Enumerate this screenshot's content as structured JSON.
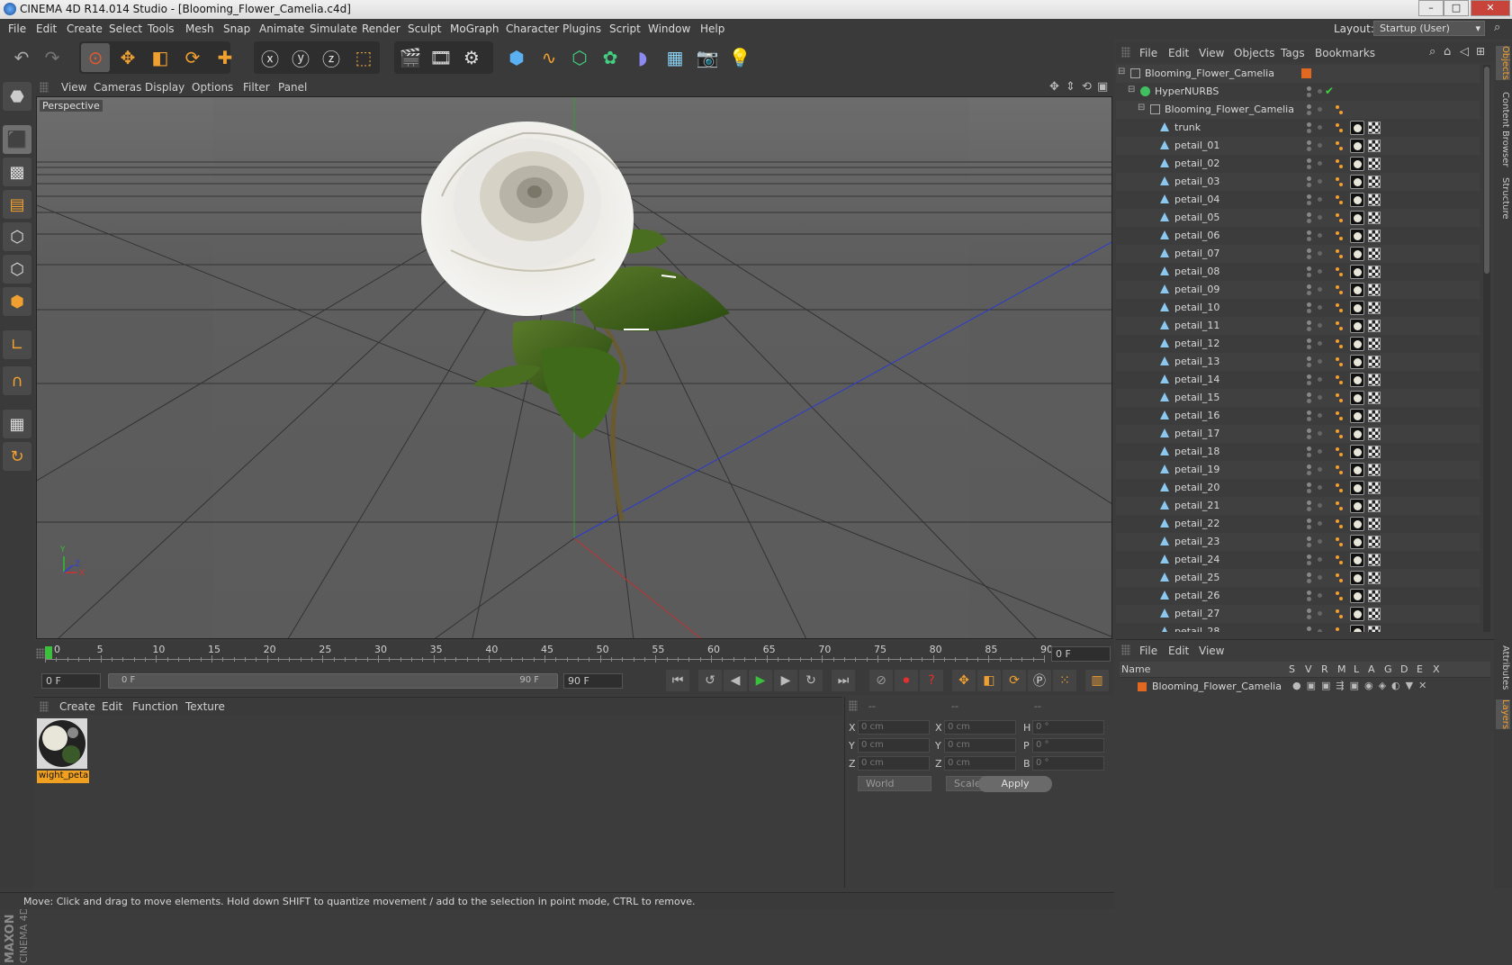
{
  "window": {
    "title": "CINEMA 4D R14.014 Studio - [Blooming_Flower_Camelia.c4d]",
    "minimize": "–",
    "maximize": "□",
    "close": "✕"
  },
  "menu": [
    "File",
    "Edit",
    "Create",
    "Select",
    "Tools",
    "Mesh",
    "Snap",
    "Animate",
    "Simulate",
    "Render",
    "Sculpt",
    "MoGraph",
    "Character",
    "Plugins",
    "Script",
    "Window",
    "Help"
  ],
  "layout": {
    "label": "Layout:",
    "value": "Startup (User)"
  },
  "viewport": {
    "menu": [
      "View",
      "Cameras",
      "Display",
      "Options",
      "Filter",
      "Panel"
    ],
    "label": "Perspective",
    "axis_y": "Y",
    "axis_z": "Z",
    "axis_x": "X"
  },
  "timeline": {
    "ticks": [
      "0",
      "5",
      "10",
      "15",
      "20",
      "25",
      "30",
      "35",
      "40",
      "45",
      "50",
      "55",
      "60",
      "65",
      "70",
      "75",
      "80",
      "85",
      "90"
    ],
    "frame": "0 F",
    "start_field": "0 F",
    "range_start": "0 F",
    "range_end": "90 F",
    "end_field": "90 F"
  },
  "materials": {
    "menu": [
      "Create",
      "Edit",
      "Function",
      "Texture"
    ],
    "items": [
      {
        "name": "wight_peta"
      }
    ]
  },
  "coords": {
    "headers": [
      "--",
      "--",
      "--"
    ],
    "rows": [
      {
        "a": "X",
        "av": "0 cm",
        "b": "X",
        "bv": "0 cm",
        "c": "H",
        "cv": "0 °"
      },
      {
        "a": "Y",
        "av": "0 cm",
        "b": "Y",
        "bv": "0 cm",
        "c": "P",
        "cv": "0 °"
      },
      {
        "a": "Z",
        "av": "0 cm",
        "b": "Z",
        "bv": "0 cm",
        "c": "B",
        "cv": "0 °"
      }
    ],
    "space": "World",
    "mode": "Scale",
    "apply": "Apply"
  },
  "status": "Move: Click and drag to move elements. Hold down SHIFT to quantize movement / add to the selection in point mode, CTRL to remove.",
  "objects": {
    "menu": [
      "File",
      "Edit",
      "View",
      "Objects",
      "Tags",
      "Bookmarks"
    ],
    "tree": [
      {
        "name": "Blooming_Flower_Camelia",
        "level": 0,
        "type": "null"
      },
      {
        "name": "HyperNURBS",
        "level": 1,
        "type": "nurbs"
      },
      {
        "name": "Blooming_Flower_Camelia",
        "level": 2,
        "type": "null"
      },
      {
        "name": "trunk",
        "level": 3,
        "type": "poly"
      },
      {
        "name": "petail_01",
        "level": 3,
        "type": "poly"
      },
      {
        "name": "petail_02",
        "level": 3,
        "type": "poly"
      },
      {
        "name": "petail_03",
        "level": 3,
        "type": "poly"
      },
      {
        "name": "petail_04",
        "level": 3,
        "type": "poly"
      },
      {
        "name": "petail_05",
        "level": 3,
        "type": "poly"
      },
      {
        "name": "petail_06",
        "level": 3,
        "type": "poly"
      },
      {
        "name": "petail_07",
        "level": 3,
        "type": "poly"
      },
      {
        "name": "petail_08",
        "level": 3,
        "type": "poly"
      },
      {
        "name": "petail_09",
        "level": 3,
        "type": "poly"
      },
      {
        "name": "petail_10",
        "level": 3,
        "type": "poly"
      },
      {
        "name": "petail_11",
        "level": 3,
        "type": "poly"
      },
      {
        "name": "petail_12",
        "level": 3,
        "type": "poly"
      },
      {
        "name": "petail_13",
        "level": 3,
        "type": "poly"
      },
      {
        "name": "petail_14",
        "level": 3,
        "type": "poly"
      },
      {
        "name": "petail_15",
        "level": 3,
        "type": "poly"
      },
      {
        "name": "petail_16",
        "level": 3,
        "type": "poly"
      },
      {
        "name": "petail_17",
        "level": 3,
        "type": "poly"
      },
      {
        "name": "petail_18",
        "level": 3,
        "type": "poly"
      },
      {
        "name": "petail_19",
        "level": 3,
        "type": "poly"
      },
      {
        "name": "petail_20",
        "level": 3,
        "type": "poly"
      },
      {
        "name": "petail_21",
        "level": 3,
        "type": "poly"
      },
      {
        "name": "petail_22",
        "level": 3,
        "type": "poly"
      },
      {
        "name": "petail_23",
        "level": 3,
        "type": "poly"
      },
      {
        "name": "petail_24",
        "level": 3,
        "type": "poly"
      },
      {
        "name": "petail_25",
        "level": 3,
        "type": "poly"
      },
      {
        "name": "petail_26",
        "level": 3,
        "type": "poly"
      },
      {
        "name": "petail_27",
        "level": 3,
        "type": "poly"
      },
      {
        "name": "petail_28",
        "level": 3,
        "type": "poly"
      }
    ]
  },
  "side_tabs": [
    "Objects",
    "Content Browser",
    "Structure",
    "Attributes",
    "Layers"
  ],
  "layers": {
    "menu": [
      "File",
      "Edit",
      "View"
    ],
    "columns": [
      "Name",
      "S",
      "V",
      "R",
      "M",
      "L",
      "A",
      "G",
      "D",
      "E",
      "X"
    ],
    "rows": [
      {
        "name": "Blooming_Flower_Camelia",
        "color": "#e06820"
      }
    ]
  },
  "colors": {
    "accent": "#f0a030",
    "selection_orange": "#e06820",
    "axis_x": "#d03030",
    "axis_y": "#30c030",
    "axis_z": "#3040d0"
  }
}
